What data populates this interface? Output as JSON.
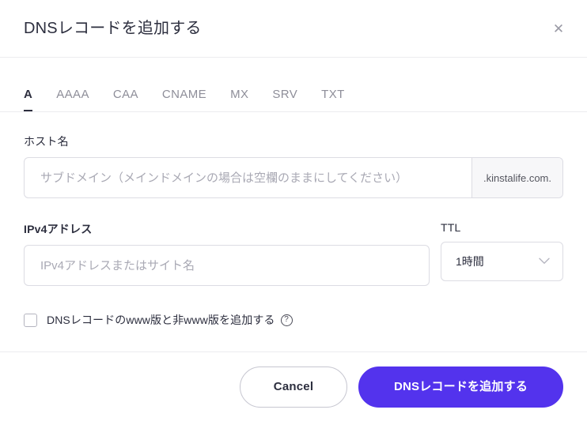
{
  "dialog": {
    "title": "DNSレコードを追加する",
    "close_label": "✕"
  },
  "tabs": [
    {
      "label": "A",
      "active": true
    },
    {
      "label": "AAAA",
      "active": false
    },
    {
      "label": "CAA",
      "active": false
    },
    {
      "label": "CNAME",
      "active": false
    },
    {
      "label": "MX",
      "active": false
    },
    {
      "label": "SRV",
      "active": false
    },
    {
      "label": "TXT",
      "active": false
    }
  ],
  "form": {
    "host": {
      "label": "ホスト名",
      "value": "",
      "placeholder": "サブドメイン（メインドメインの場合は空欄のままにしてください）",
      "suffix": ".kinstalife.com."
    },
    "ipv4": {
      "label": "IPv4アドレス",
      "value": "",
      "placeholder": "IPv4アドレスまたはサイト名"
    },
    "ttl": {
      "label": "TTL",
      "selected": "1時間",
      "options": [
        "1時間"
      ]
    },
    "www_checkbox": {
      "label": "DNSレコードのwww版と非www版を追加する",
      "checked": false,
      "help": "?"
    }
  },
  "footer": {
    "cancel_label": "Cancel",
    "submit_label": "DNSレコードを追加する"
  },
  "colors": {
    "accent": "#5333ed",
    "text": "#2c2e3e",
    "muted": "#8e8e99",
    "border": "#dcdce3"
  }
}
